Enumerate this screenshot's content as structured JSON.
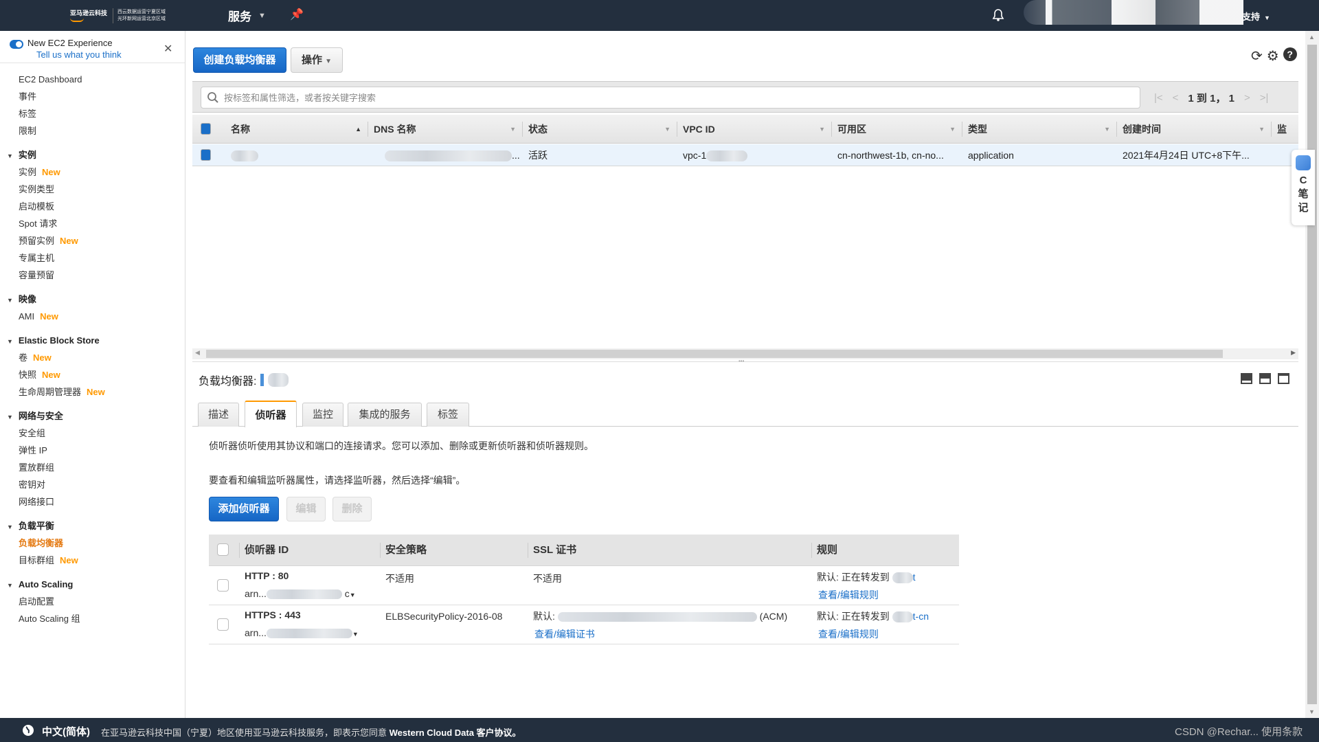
{
  "topnav": {
    "logo_text": "亚马逊云科技",
    "region_line1": "西云数据运营宁夏区域",
    "region_line2": "光环新网运营北京区域",
    "services_label": "服务",
    "support_label": "支持"
  },
  "sidebar": {
    "experience_title": "New EC2 Experience",
    "experience_link": "Tell us what you think",
    "top_items": [
      {
        "label": "EC2 Dashboard"
      },
      {
        "label": "事件"
      },
      {
        "label": "标签"
      },
      {
        "label": "限制"
      }
    ],
    "sections": [
      {
        "title": "实例",
        "items": [
          {
            "label": "实例",
            "badge": "New"
          },
          {
            "label": "实例类型",
            "badge": ""
          },
          {
            "label": "启动模板",
            "badge": ""
          },
          {
            "label": "Spot 请求",
            "badge": ""
          },
          {
            "label": "预留实例",
            "badge": "New"
          },
          {
            "label": "专属主机",
            "badge": ""
          },
          {
            "label": "容量预留",
            "badge": ""
          }
        ]
      },
      {
        "title": "映像",
        "items": [
          {
            "label": "AMI",
            "badge": "New"
          }
        ]
      },
      {
        "title": "Elastic Block Store",
        "items": [
          {
            "label": "卷",
            "badge": "New"
          },
          {
            "label": "快照",
            "badge": "New"
          },
          {
            "label": "生命周期管理器",
            "badge": "New"
          }
        ]
      },
      {
        "title": "网络与安全",
        "items": [
          {
            "label": "安全组",
            "badge": ""
          },
          {
            "label": "弹性 IP",
            "badge": ""
          },
          {
            "label": "置放群组",
            "badge": ""
          },
          {
            "label": "密钥对",
            "badge": ""
          },
          {
            "label": "网络接口",
            "badge": ""
          }
        ]
      },
      {
        "title": "负载平衡",
        "items": [
          {
            "label": "负载均衡器",
            "badge": "",
            "active": true
          },
          {
            "label": "目标群组",
            "badge": "New"
          }
        ]
      },
      {
        "title": "Auto Scaling",
        "items": [
          {
            "label": "启动配置",
            "badge": ""
          },
          {
            "label": "Auto Scaling 组",
            "badge": ""
          }
        ]
      }
    ]
  },
  "toolbar": {
    "create_label": "创建负载均衡器",
    "actions_label": "操作"
  },
  "filter": {
    "placeholder": "按标签和属性筛选，或者按关键字搜索",
    "pager_text": "1 到 1， 1"
  },
  "grid": {
    "columns": [
      "名称",
      "DNS 名称",
      "状态",
      "VPC ID",
      "可用区",
      "类型",
      "创建时间",
      "监"
    ],
    "rows": [
      {
        "name": "",
        "dns": "...",
        "state": "活跃",
        "vpc": "vpc-1",
        "az": "cn-northwest-1b, cn-no...",
        "type": "application",
        "created": "2021年4月24日 UTC+8下午..."
      }
    ]
  },
  "detail": {
    "title": "负载均衡器:",
    "tabs": [
      "描述",
      "侦听器",
      "监控",
      "集成的服务",
      "标签"
    ],
    "active_tab": "侦听器",
    "desc1": "侦听器侦听使用其协议和端口的连接请求。您可以添加、删除或更新侦听器和侦听器规则。",
    "desc2": "要查看和编辑监听器属性，请选择监听器，然后选择“编辑”。",
    "add_label": "添加侦听器",
    "edit_label": "编辑",
    "delete_label": "删除",
    "listener_columns": [
      "侦听器 ID",
      "安全策略",
      "SSL 证书",
      "规则"
    ],
    "listeners": [
      {
        "id": "HTTP : 80",
        "arn": "arn...",
        "arn_tail": "c",
        "policy": "不适用",
        "cert": "不适用",
        "cert_link": "",
        "rule_text": "默认:  正在转发到",
        "rule_tail": "t",
        "rule_link": "查看/编辑规则"
      },
      {
        "id": "HTTPS : 443",
        "arn": "arn...",
        "arn_tail": "",
        "policy": "ELBSecurityPolicy-2016-08",
        "cert": "默认:",
        "cert_suffix": "(ACM)",
        "cert_link": "查看/编辑证书",
        "rule_text": "默认:  正在转发到",
        "rule_tail": "t-cn",
        "rule_link": "查看/编辑规则"
      }
    ]
  },
  "note_widget": {
    "label": "C笔记"
  },
  "footer": {
    "language": "中文(简体)",
    "notice_prefix": "在亚马逊云科技中国（宁夏）地区使用亚马逊云科技服务，即表示您同意",
    "notice_link": "Western Cloud Data 客户协议。",
    "right_text": "CSDN @Rechar... 使用条款"
  },
  "colors": {
    "accent": "#ff9900",
    "primary": "#1a6fc8",
    "nav_bg": "#232f3e"
  }
}
